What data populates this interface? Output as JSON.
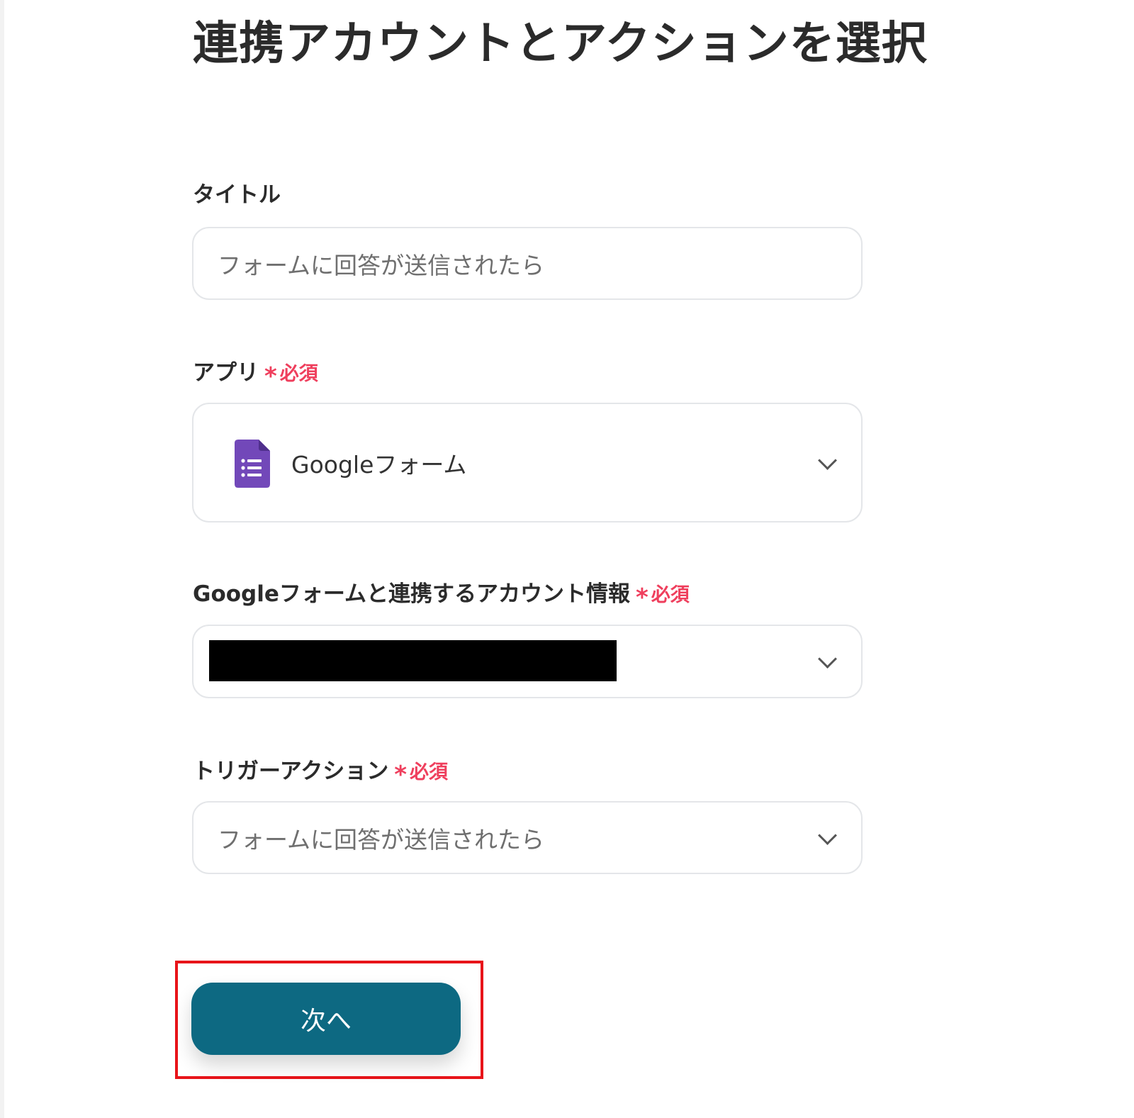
{
  "page": {
    "title": "連携アカウントとアクションを選択"
  },
  "required": {
    "mark": "*",
    "text": "必須"
  },
  "title_field": {
    "label": "タイトル",
    "value": "フォームに回答が送信されたら"
  },
  "app_field": {
    "label": "アプリ",
    "value": "Googleフォーム",
    "icon": "google-forms-icon",
    "icon_color": "#7248b9"
  },
  "account_field": {
    "label": "Googleフォームと連携するアカウント情報",
    "value": ""
  },
  "trigger_field": {
    "label": "トリガーアクション",
    "value": "フォームに回答が送信されたら"
  },
  "next_button": {
    "label": "次へ",
    "color": "#0d6982"
  },
  "colors": {
    "required": "#ef3f5d",
    "highlight": "#e8141a"
  }
}
